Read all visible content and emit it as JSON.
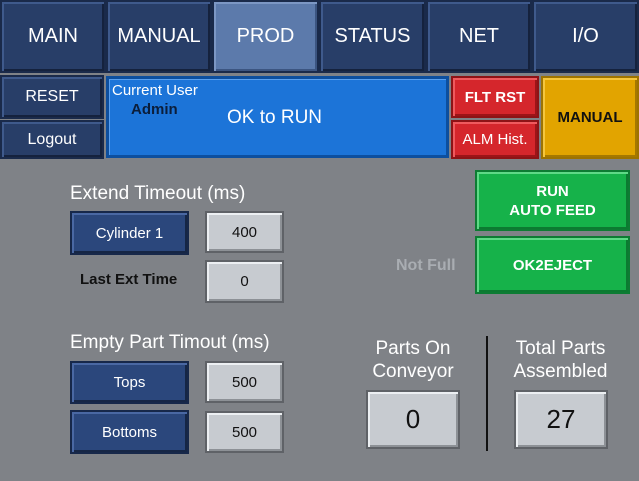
{
  "nav": {
    "tabs": [
      {
        "label": "MAIN"
      },
      {
        "label": "MANUAL"
      },
      {
        "label": "PROD"
      },
      {
        "label": "STATUS"
      },
      {
        "label": "NET"
      },
      {
        "label": "I/O"
      }
    ],
    "active_tab": "PROD"
  },
  "left_buttons": {
    "reset": "RESET",
    "logout": "Logout"
  },
  "status_panel": {
    "current_user_label": "Current User",
    "user": "Admin",
    "message": "OK to RUN"
  },
  "right_buttons": {
    "fault_reset": "FLT RST",
    "alarm_history": "ALM Hist.",
    "mode": "MANUAL"
  },
  "extend": {
    "title": "Extend Timeout (ms)",
    "cylinder_button": "Cylinder 1",
    "cylinder_value": "400",
    "last_ext_label": "Last Ext Time",
    "last_ext_value": "0"
  },
  "empty_part": {
    "title": "Empty Part Timout (ms)",
    "tops_button": "Tops",
    "tops_value": "500",
    "bottoms_button": "Bottoms",
    "bottoms_value": "500"
  },
  "feed": {
    "run_line1": "RUN",
    "run_line2": "AUTO FEED",
    "not_full": "Not Full",
    "ok2eject": "OK2EJECT"
  },
  "counters": {
    "parts_on_line1": "Parts On",
    "parts_on_line2": "Conveyor",
    "parts_on_value": "0",
    "total_line1": "Total Parts",
    "total_line2": "Assembled",
    "total_value": "27"
  },
  "colors": {
    "background": "#7f8287",
    "nav": "#283e68",
    "nav_active": "#5c7aab",
    "status_blue": "#1c74d8",
    "alarm_red": "#d5262c",
    "mode_amber": "#e2a400",
    "run_green": "#16b24a"
  }
}
